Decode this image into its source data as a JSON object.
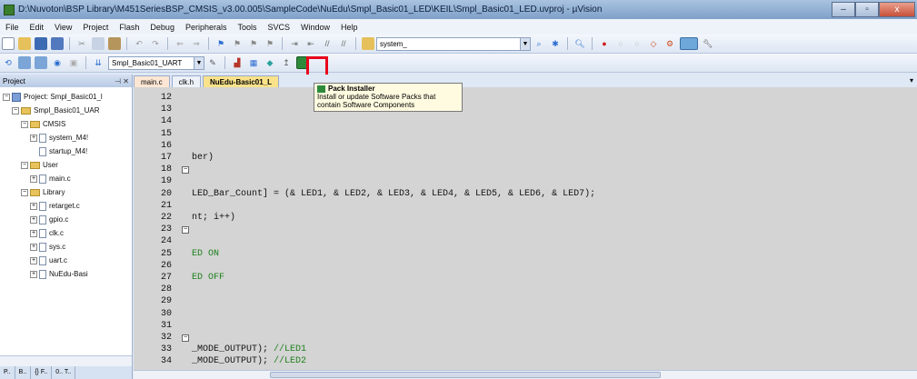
{
  "window": {
    "title": "D:\\Nuvoton\\BSP Library\\M451SeriesBSP_CMSIS_v3.00.005\\SampleCode\\NuEdu\\Smpl_Basic01_LED\\KEIL\\Smpl_Basic01_LED.uvproj - µVision",
    "controls": [
      "–",
      "▫",
      "x"
    ]
  },
  "menu": [
    "File",
    "Edit",
    "View",
    "Project",
    "Flash",
    "Debug",
    "Peripherals",
    "Tools",
    "SVCS",
    "Window",
    "Help"
  ],
  "toolbar1": {
    "find_combo_value": "system_"
  },
  "toolbar2": {
    "target_combo_value": "Smpl_Basic01_UART"
  },
  "project_panel": {
    "title": "Project",
    "tree": [
      {
        "label": "Project: Smpl_Basic01_l",
        "level": 0,
        "kind": "project",
        "toggle": "⊟"
      },
      {
        "label": "Smpl_Basic01_UAR",
        "level": 1,
        "kind": "target",
        "toggle": "⊟"
      },
      {
        "label": "CMSIS",
        "level": 2,
        "kind": "folder",
        "toggle": "⊟"
      },
      {
        "label": "system_M4!",
        "level": 3,
        "kind": "file",
        "toggle": "⊞"
      },
      {
        "label": "startup_M4!",
        "level": 3,
        "kind": "file",
        "toggle": ""
      },
      {
        "label": "User",
        "level": 2,
        "kind": "folder",
        "toggle": "⊟"
      },
      {
        "label": "main.c",
        "level": 3,
        "kind": "file",
        "toggle": "⊞"
      },
      {
        "label": "Library",
        "level": 2,
        "kind": "folder",
        "toggle": "⊟"
      },
      {
        "label": "retarget.c",
        "level": 3,
        "kind": "file",
        "toggle": "⊞"
      },
      {
        "label": "gpio.c",
        "level": 3,
        "kind": "file",
        "toggle": "⊞"
      },
      {
        "label": "clk.c",
        "level": 3,
        "kind": "file",
        "toggle": "⊞"
      },
      {
        "label": "sys.c",
        "level": 3,
        "kind": "file",
        "toggle": "⊞"
      },
      {
        "label": "uart.c",
        "level": 3,
        "kind": "file",
        "toggle": "⊞"
      },
      {
        "label": "NuEdu-Basi",
        "level": 3,
        "kind": "file",
        "toggle": "⊞"
      }
    ],
    "bottom_tabs": [
      "P..",
      "B..",
      "{} F..",
      "0.. T.."
    ]
  },
  "editor_tabs": [
    {
      "label": "main.c",
      "state": "file1"
    },
    {
      "label": "clk.h",
      "state": "normal"
    },
    {
      "label": "NuEdu-Basic01_L",
      "state": "active"
    }
  ],
  "tooltip": {
    "title": "Pack Installer",
    "body": "Install or update Software Packs that contain Software Components"
  },
  "code_lines": [
    {
      "n": "12",
      "code": "",
      "fold": false
    },
    {
      "n": "13",
      "code": "",
      "fold": false
    },
    {
      "n": "14",
      "code": "",
      "fold": false
    },
    {
      "n": "15",
      "code": "",
      "fold": false
    },
    {
      "n": "16",
      "code": "",
      "fold": false
    },
    {
      "n": "17",
      "code": "ber)",
      "fold": false
    },
    {
      "n": "18",
      "code": "",
      "fold": true
    },
    {
      "n": "19",
      "code": "",
      "fold": false
    },
    {
      "n": "20",
      "code": "LED_Bar_Count] = (& LED1, & LED2, & LED3, & LED4, & LED5, & LED6, & LED7);",
      "fold": false
    },
    {
      "n": "21",
      "code": "",
      "fold": false
    },
    {
      "n": "22",
      "code": "nt; i++)",
      "fold": false
    },
    {
      "n": "23",
      "code": "",
      "fold": true
    },
    {
      "n": "24",
      "code": "",
      "fold": false
    },
    {
      "n": "25",
      "code": "ED ON",
      "fold": false,
      "comment": true
    },
    {
      "n": "26",
      "code": "",
      "fold": false
    },
    {
      "n": "27",
      "code": "ED OFF",
      "fold": false,
      "comment": true
    },
    {
      "n": "28",
      "code": "",
      "fold": false
    },
    {
      "n": "29",
      "code": "",
      "fold": false
    },
    {
      "n": "30",
      "code": "",
      "fold": false
    },
    {
      "n": "31",
      "code": "",
      "fold": false
    },
    {
      "n": "32",
      "code": "",
      "fold": true
    },
    {
      "n": "33",
      "code": "_MODE_OUTPUT); //LED1",
      "fold": false,
      "split": "_MODE_OUTPUT); ",
      "tail": "//LED1"
    },
    {
      "n": "34",
      "code": "_MODE_OUTPUT); //LED2",
      "fold": false,
      "split": "_MODE_OUTPUT); ",
      "tail": "//LED2"
    }
  ],
  "hscroll_label": "III"
}
